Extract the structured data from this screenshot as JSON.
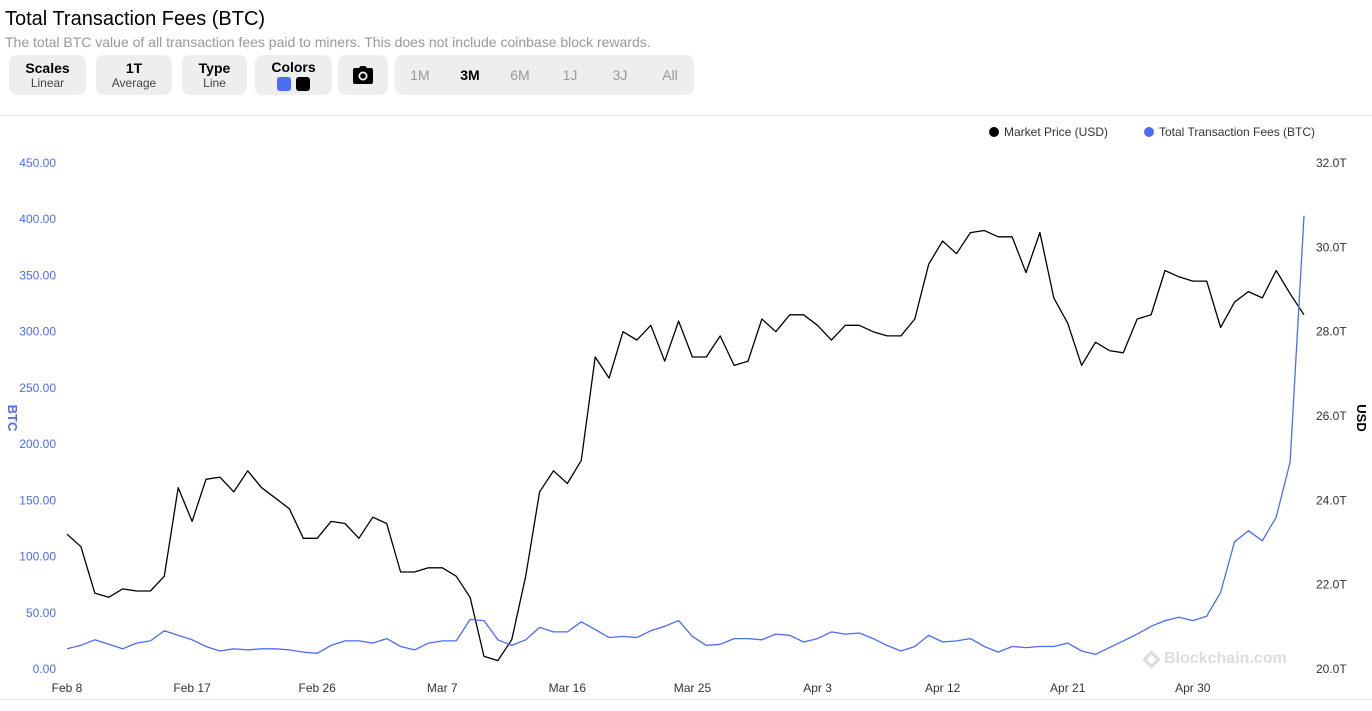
{
  "header": {
    "title": "Total Transaction Fees (BTC)",
    "subtitle": "The total BTC value of all transaction fees paid to miners. This does not include coinbase block rewards."
  },
  "toolbar": {
    "scales": {
      "label": "Scales",
      "value": "Linear"
    },
    "average": {
      "label": "1T",
      "value": "Average"
    },
    "type": {
      "label": "Type",
      "value": "Line"
    },
    "colors": {
      "label": "Colors",
      "primary": "#4a6cf7",
      "secondary": "#000000"
    },
    "camera_icon": "camera-icon",
    "ranges": [
      "1M",
      "3M",
      "6M",
      "1J",
      "3J",
      "All"
    ],
    "active_range": "3M"
  },
  "legend": {
    "price": "Market Price (USD)",
    "fees": "Total Transaction Fees (BTC)"
  },
  "watermark": "Blockchain.com",
  "chart_data": {
    "type": "line",
    "x_tick_labels": [
      "Feb 8",
      "Feb 17",
      "Feb 26",
      "Mar 7",
      "Mar 16",
      "Mar 25",
      "Apr 3",
      "Apr 12",
      "Apr 21",
      "Apr 30"
    ],
    "y_left": {
      "label": "BTC",
      "ticks": [
        "0.00",
        "50.00",
        "100.00",
        "150.00",
        "200.00",
        "250.00",
        "300.00",
        "350.00",
        "400.00",
        "450.00"
      ],
      "range": [
        0,
        450
      ]
    },
    "y_right": {
      "label": "USD",
      "ticks": [
        "20.0T",
        "22.0T",
        "24.0T",
        "26.0T",
        "28.0T",
        "30.0T",
        "32.0T"
      ],
      "range": [
        20,
        32
      ]
    },
    "series": [
      {
        "name": "Market Price (USD)",
        "axis": "right",
        "color": "#000000",
        "values": [
          23.2,
          22.9,
          21.8,
          21.7,
          21.9,
          21.85,
          21.85,
          22.2,
          24.3,
          23.5,
          24.5,
          24.55,
          24.2,
          24.7,
          24.3,
          24.05,
          23.8,
          23.1,
          23.1,
          23.5,
          23.45,
          23.1,
          23.6,
          23.45,
          22.3,
          22.3,
          22.4,
          22.4,
          22.2,
          21.7,
          20.3,
          20.2,
          20.7,
          22.2,
          24.2,
          24.7,
          24.4,
          24.95,
          27.4,
          26.9,
          28.0,
          27.8,
          28.15,
          27.3,
          28.25,
          27.4,
          27.4,
          27.9,
          27.2,
          27.3,
          28.3,
          28.0,
          28.4,
          28.4,
          28.15,
          27.8,
          28.15,
          28.15,
          28.0,
          27.9,
          27.9,
          28.3,
          29.6,
          30.15,
          29.85,
          30.35,
          30.4,
          30.25,
          30.25,
          29.4,
          30.35,
          28.8,
          28.2,
          27.2,
          27.75,
          27.55,
          27.5,
          28.3,
          28.4,
          29.45,
          29.3,
          29.2,
          29.2,
          28.1,
          28.7,
          28.95,
          28.8,
          29.45,
          28.9,
          28.4
        ]
      },
      {
        "name": "Total Transaction Fees (BTC)",
        "axis": "left",
        "color": "#4a6cf7",
        "values": [
          18,
          21,
          26,
          22,
          18,
          23,
          25,
          34,
          30,
          26,
          20,
          16,
          18,
          17,
          18,
          18,
          17,
          15,
          14,
          21,
          25,
          25,
          23,
          27,
          20,
          17,
          23,
          25,
          25,
          44,
          43,
          26,
          21,
          26,
          37,
          33,
          33,
          42,
          35,
          28,
          29,
          28,
          34,
          38,
          43,
          29,
          21,
          22,
          27,
          27,
          26,
          31,
          30,
          24,
          27,
          33,
          31,
          32,
          27,
          21,
          16,
          20,
          30,
          24,
          25,
          27,
          20,
          15,
          20,
          19,
          20,
          20,
          23,
          16,
          13,
          19,
          25,
          31,
          38,
          43,
          46,
          43,
          47,
          68,
          113,
          123,
          114,
          135,
          184,
          403
        ]
      }
    ]
  }
}
